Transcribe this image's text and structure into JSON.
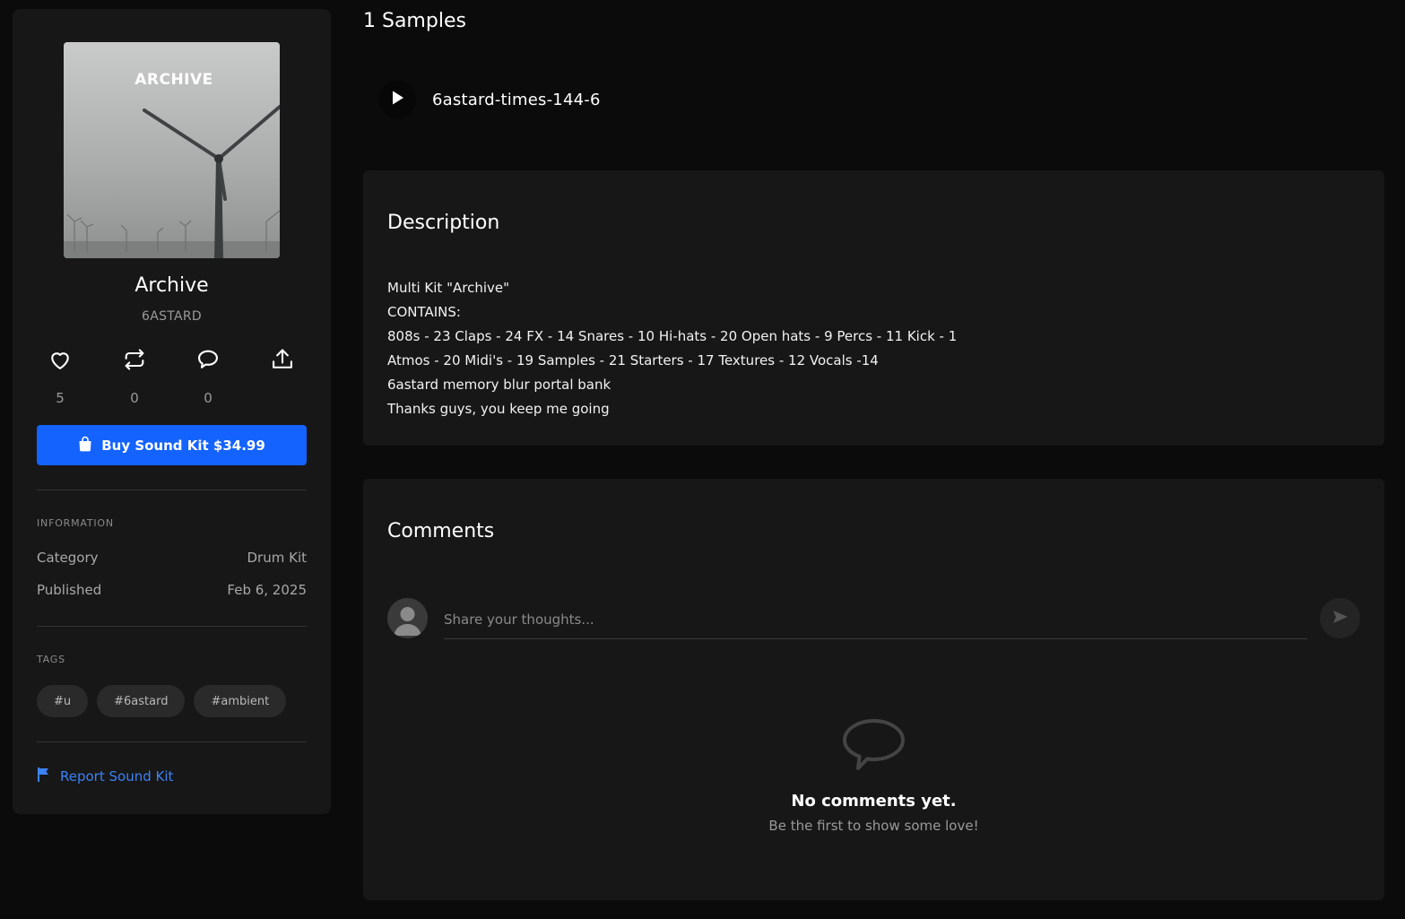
{
  "kit": {
    "cover_text": "ARCHIVE",
    "title": "Archive",
    "author": "6ASTARD",
    "buy_label": "Buy Sound Kit $34.99",
    "report_label": "Report Sound Kit"
  },
  "actions": [
    {
      "name": "like",
      "icon": "heart-icon",
      "count": "5"
    },
    {
      "name": "repost",
      "icon": "repost-icon",
      "count": "0"
    },
    {
      "name": "comment",
      "icon": "comment-icon",
      "count": "0"
    },
    {
      "name": "share",
      "icon": "share-icon",
      "count": ""
    }
  ],
  "information": {
    "heading": "INFORMATION",
    "rows": [
      {
        "label": "Category",
        "value": "Drum Kit"
      },
      {
        "label": "Published",
        "value": "Feb 6, 2025"
      }
    ]
  },
  "tags": {
    "heading": "TAGS",
    "items": [
      "#u",
      "#6astard",
      "#ambient"
    ]
  },
  "samples": {
    "heading": "1 Samples",
    "items": [
      {
        "name": "6astard-times-144-6"
      }
    ]
  },
  "description": {
    "heading": "Description",
    "lines": [
      "Multi Kit \"Archive\"",
      "CONTAINS:",
      "808s - 23 Claps - 24 FX - 14 Snares - 10 Hi-hats - 20 Open hats - 9 Percs - 11 Kick - 1",
      "Atmos - 20 Midi's - 19 Samples - 21 Starters - 17 Textures - 12 Vocals -14",
      "6astard memory blur portal bank",
      "Thanks guys, you keep me going"
    ]
  },
  "comments": {
    "heading": "Comments",
    "placeholder": "Share your thoughts...",
    "empty_title": "No comments yet.",
    "empty_subtitle": "Be the first to show some love!"
  },
  "colors": {
    "accent": "#1463ff",
    "link": "#3b82f6",
    "background": "#0b0b0b",
    "card": "#171717"
  }
}
